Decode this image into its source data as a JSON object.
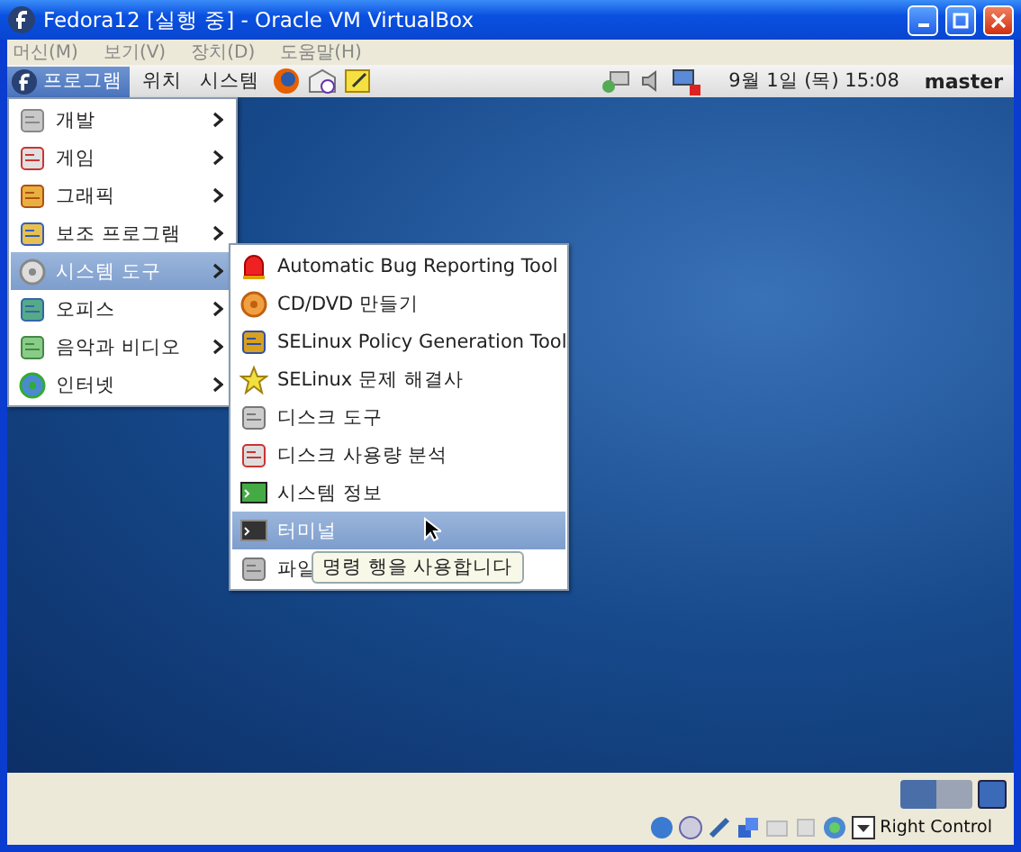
{
  "window": {
    "title": "Fedora12 [실행 중] - Oracle VM VirtualBox"
  },
  "menu_bar": [
    "머신(M)",
    "보기(V)",
    "장치(D)",
    "도움말(H)"
  ],
  "panel": {
    "menus": [
      {
        "label": "프로그램",
        "selected": true
      },
      {
        "label": "위치",
        "selected": false
      },
      {
        "label": "시스템",
        "selected": false
      }
    ],
    "clock": "9월 1일 (목) 15:08",
    "user": "master"
  },
  "applications_menu": {
    "items": [
      {
        "label": "개발",
        "selected": false
      },
      {
        "label": "게임",
        "selected": false
      },
      {
        "label": "그래픽",
        "selected": false
      },
      {
        "label": "보조 프로그램",
        "selected": false
      },
      {
        "label": "시스템 도구",
        "selected": true
      },
      {
        "label": "오피스",
        "selected": false
      },
      {
        "label": "음악과 비디오",
        "selected": false
      },
      {
        "label": "인터넷",
        "selected": false
      }
    ]
  },
  "system_tools_menu": {
    "items": [
      {
        "label": "Automatic Bug Reporting Tool",
        "selected": false
      },
      {
        "label": "CD/DVD 만들기",
        "selected": false
      },
      {
        "label": "SELinux Policy Generation Tool",
        "selected": false
      },
      {
        "label": "SELinux 문제 해결사",
        "selected": false
      },
      {
        "label": "디스크 도구",
        "selected": false
      },
      {
        "label": "디스크 사용량 분석",
        "selected": false
      },
      {
        "label": "시스템 정보",
        "selected": false
      },
      {
        "label": "터미널",
        "selected": true
      },
      {
        "label": "파일",
        "selected": false
      }
    ]
  },
  "tooltip": "명령 행을 사용합니다",
  "status_bar": {
    "host_key": "Right Control"
  }
}
